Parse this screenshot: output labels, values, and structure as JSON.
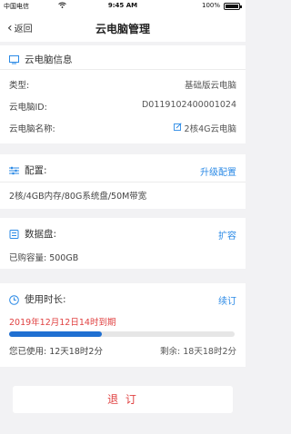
{
  "status_bar": {
    "carrier": "中国电信",
    "time": "9:45 AM",
    "battery": "100%"
  },
  "nav": {
    "back_label": "返回",
    "title": "云电脑管理"
  },
  "info": {
    "header": "云电脑信息",
    "type_label": "类型:",
    "type_value": "基础版云电脑",
    "id_label": "云电脑ID:",
    "id_value": "D0119102400001024",
    "name_label": "云电脑名称:",
    "name_value": "2核4G云电脑"
  },
  "config": {
    "header": "配置:",
    "action": "升级配置",
    "detail": "2核/4GB内存/80G系统盘/50M带宽"
  },
  "disk": {
    "header": "数据盘:",
    "action": "扩容",
    "purchased": "已购容量: 500GB"
  },
  "usage": {
    "header": "使用时长:",
    "action": "续订",
    "expiry": "2019年12月12日14时到期",
    "used": "您已使用: 12天18时2分",
    "remaining": "剩余: 18天18时2分",
    "progress_fraction": 0.41
  },
  "footer": {
    "cancel_label": "退 订"
  },
  "colors": {
    "accent": "#2b8ae6",
    "progress": "#1f6fd1",
    "expiry": "#e04242",
    "cancel": "#e04242"
  }
}
